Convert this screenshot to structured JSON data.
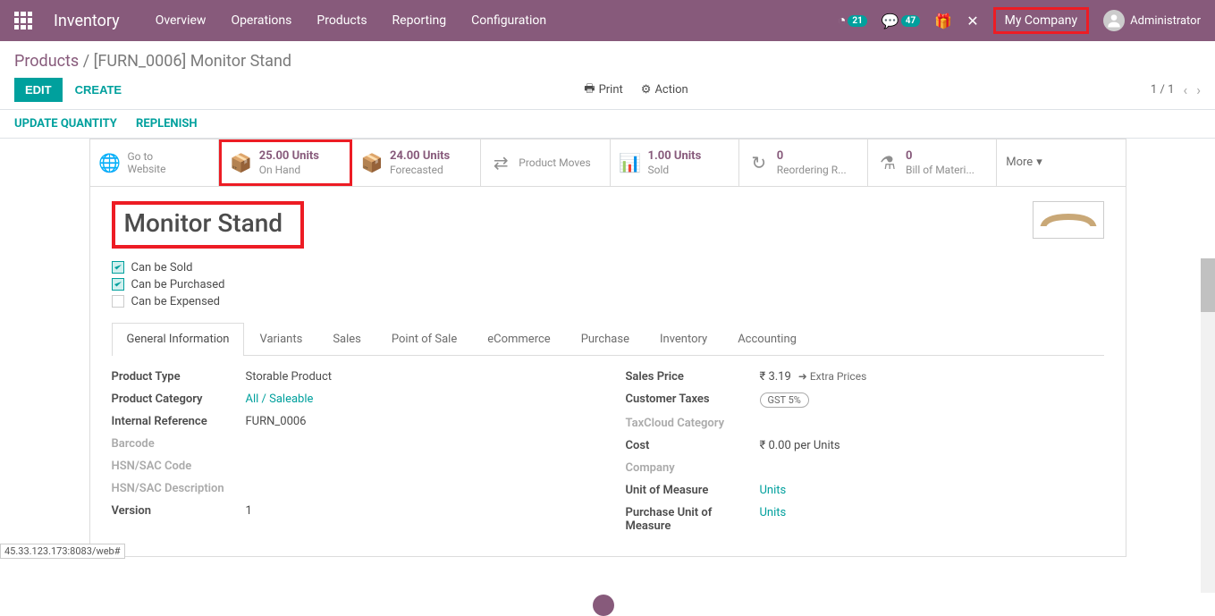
{
  "topbar": {
    "app_title": "Inventory",
    "menu": [
      "Overview",
      "Operations",
      "Products",
      "Reporting",
      "Configuration"
    ],
    "timer_badge": "21",
    "chat_badge": "47",
    "company": "My Company",
    "user": "Administrator"
  },
  "breadcrumb": {
    "parent": "Products",
    "current": "[FURN_0006] Monitor Stand"
  },
  "buttons": {
    "edit": "EDIT",
    "create": "CREATE",
    "print": "Print",
    "action": "Action",
    "update_qty": "UPDATE QUANTITY",
    "replenish": "REPLENISH"
  },
  "pager": {
    "pos": "1",
    "total": "1"
  },
  "stats": {
    "website": {
      "label": "Go to",
      "sub": "Website"
    },
    "onhand": {
      "val": "25.00 Units",
      "lbl": "On Hand"
    },
    "forecast": {
      "val": "24.00 Units",
      "lbl": "Forecasted"
    },
    "moves": {
      "lbl": "Product Moves"
    },
    "sold": {
      "val": "1.00 Units",
      "lbl": "Sold"
    },
    "reorder": {
      "val": "0",
      "lbl": "Reordering R..."
    },
    "bom": {
      "val": "0",
      "lbl": "Bill of Materi..."
    },
    "more": "More"
  },
  "product": {
    "name": "Monitor Stand",
    "can_sold": "Can be Sold",
    "can_purchased": "Can be Purchased",
    "can_expensed": "Can be Expensed"
  },
  "tabs": [
    "General Information",
    "Variants",
    "Sales",
    "Point of Sale",
    "eCommerce",
    "Purchase",
    "Inventory",
    "Accounting"
  ],
  "fields": {
    "left": {
      "product_type": {
        "label": "Product Type",
        "value": "Storable Product"
      },
      "category": {
        "label": "Product Category",
        "value": "All / Saleable"
      },
      "internal_ref": {
        "label": "Internal Reference",
        "value": "FURN_0006"
      },
      "barcode": {
        "label": "Barcode",
        "value": ""
      },
      "hsn": {
        "label": "HSN/SAC Code",
        "value": ""
      },
      "hsn_desc": {
        "label": "HSN/SAC Description",
        "value": ""
      },
      "version": {
        "label": "Version",
        "value": "1"
      }
    },
    "right": {
      "sales_price": {
        "label": "Sales Price",
        "value": "₹ 3.19",
        "extra": "Extra Prices"
      },
      "cust_taxes": {
        "label": "Customer Taxes",
        "value": "GST 5%"
      },
      "taxcloud": {
        "label": "TaxCloud Category",
        "value": ""
      },
      "cost": {
        "label": "Cost",
        "value": "₹ 0.00  per Units"
      },
      "company": {
        "label": "Company",
        "value": ""
      },
      "uom": {
        "label": "Unit of Measure",
        "value": "Units"
      },
      "puom": {
        "label": "Purchase Unit of Measure",
        "value": "Units"
      }
    }
  },
  "footer_url": "45.33.123.173:8083/web#"
}
